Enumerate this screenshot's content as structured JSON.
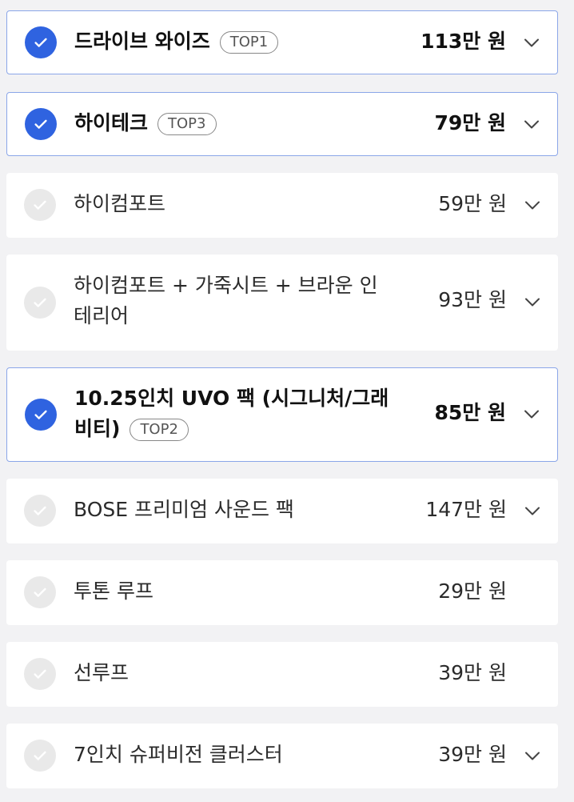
{
  "options": [
    {
      "name": "드라이브 와이즈",
      "badge": "TOP1",
      "price": "113만 원",
      "selected": true,
      "has_chevron": true
    },
    {
      "name": "하이테크",
      "badge": "TOP3",
      "price": "79만 원",
      "selected": true,
      "has_chevron": true
    },
    {
      "name": "하이컴포트",
      "badge": "",
      "price": "59만 원",
      "selected": false,
      "has_chevron": true
    },
    {
      "name": "하이컴포트 + 가죽시트 + 브라운 인테리어",
      "badge": "",
      "price": "93만 원",
      "selected": false,
      "has_chevron": true
    },
    {
      "name": "10.25인치 UVO 팩 (시그니처/그래비티)",
      "badge": "TOP2",
      "price": "85만 원",
      "selected": true,
      "has_chevron": true
    },
    {
      "name": "BOSE 프리미엄 사운드 팩",
      "badge": "",
      "price": "147만 원",
      "selected": false,
      "has_chevron": true
    },
    {
      "name": "투톤 루프",
      "badge": "",
      "price": "29만 원",
      "selected": false,
      "has_chevron": false
    },
    {
      "name": "선루프",
      "badge": "",
      "price": "39만 원",
      "selected": false,
      "has_chevron": false
    },
    {
      "name": "7인치 슈퍼비전 클러스터",
      "badge": "",
      "price": "39만 원",
      "selected": false,
      "has_chevron": true
    }
  ],
  "colors": {
    "accent": "#2f63e0",
    "selected_border": "#8ba6e8",
    "unchecked": "#e9e9e9",
    "background": "#f2f2f4"
  },
  "icons": {
    "check": "check-icon",
    "expand": "chevron-down-icon"
  }
}
